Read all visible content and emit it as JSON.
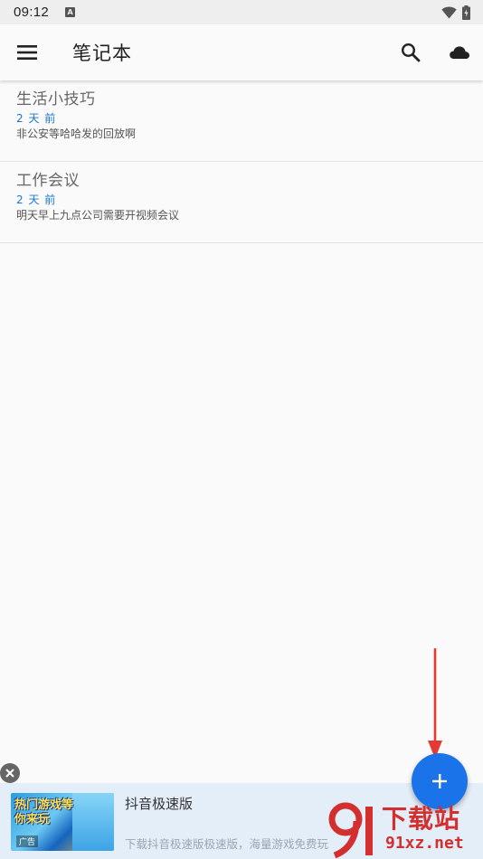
{
  "status_bar": {
    "time": "09:12",
    "notification_icon": "a-icon",
    "wifi_icon": "wifi-icon",
    "battery_icon": "battery-charging-icon"
  },
  "app_bar": {
    "title": "笔记本",
    "menu_icon": "menu-icon",
    "search_icon": "search-icon",
    "cloud_icon": "cloud-icon"
  },
  "notes": [
    {
      "title": "生活小技巧",
      "date": "2 天 前",
      "preview": "非公安等哈哈发的回放啊"
    },
    {
      "title": "工作会议",
      "date": "2 天 前",
      "preview": "明天早上九点公司需要开视频会议"
    }
  ],
  "fab": {
    "icon": "plus-icon",
    "color": "#1a73e8"
  },
  "ad": {
    "close_icon": "close-icon",
    "image_text": "热门游戏等你来玩",
    "image_tag": "广告",
    "title": "抖音极速版",
    "description": "下载抖音极速版极速版，海量游戏免费玩"
  },
  "watermark": {
    "main": "下载站",
    "sub": "91xz.net"
  },
  "colors": {
    "accent": "#1a73e8",
    "date_blue": "#1976d2",
    "annotation_red": "#e53935"
  }
}
